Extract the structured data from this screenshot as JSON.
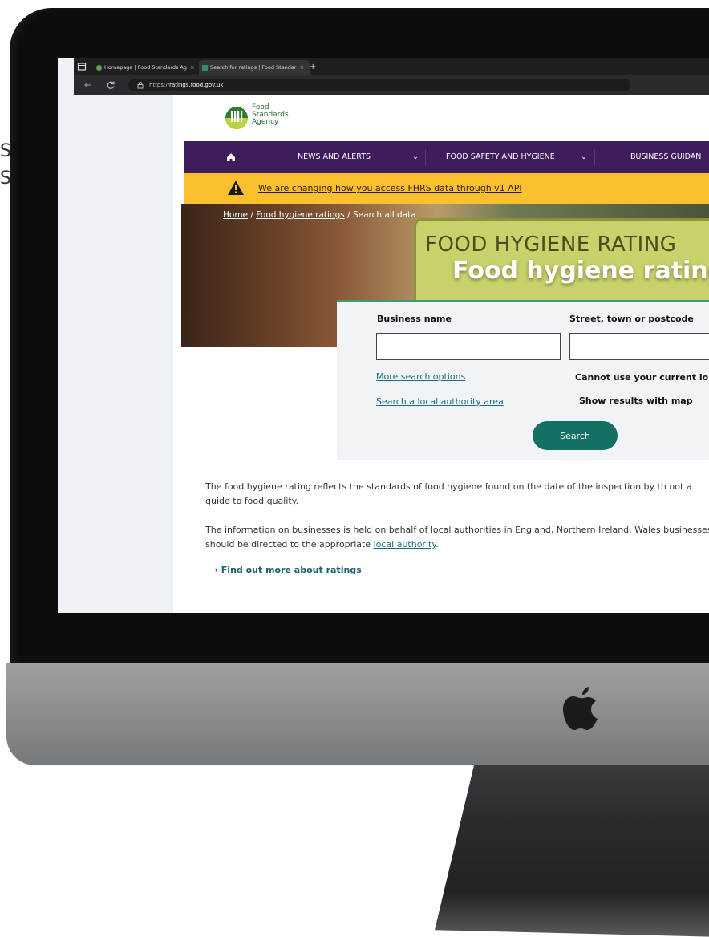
{
  "edge_text": [
    "S",
    "S"
  ],
  "browser": {
    "tabs": [
      {
        "label": "Homepage | Food Standards Ag",
        "close": "×"
      },
      {
        "label": "Search for ratings | Food Standar",
        "close": "×"
      }
    ],
    "new_tab": "+",
    "url_prefix": "https://",
    "url_host": "ratings.food.gov.uk"
  },
  "site": {
    "logo_lines": [
      "Food",
      "Standards",
      "Agency"
    ],
    "nav": [
      {
        "label": "NEWS AND ALERTS",
        "caret": "⌄"
      },
      {
        "label": "FOOD SAFETY AND HYGIENE",
        "caret": "⌄"
      },
      {
        "label": "BUSINESS GUIDAN"
      }
    ],
    "alert_text": "We are changing how you access FHRS data through v1 API",
    "breadcrumb": {
      "home": "Home",
      "sep1": "/",
      "ratings": "Food hygiene ratings",
      "sep2": "/",
      "current": "Search all data"
    },
    "hero_sign_text": "FOOD HYGIENE RATING",
    "hero_title": "Food hygiene ratings",
    "search": {
      "business_label": "Business name",
      "location_label": "Street, town or postcode",
      "more_options": "More search options",
      "local_authority": "Search a local authority area",
      "location_note": "Cannot use your current lo",
      "map_toggle": "Show results with map",
      "button": "Search"
    },
    "para1": "The food hygiene rating reflects the standards of food hygiene found on the date of the inspection by th not a guide to food quality.",
    "para2_prefix": "The information on businesses is held on behalf of local authorities in England, Northern Ireland, Wales businesses should be directed to the appropriate",
    "para2_link": "local authority",
    "para2_suffix": ".",
    "more_link": "Find out more about ratings",
    "more_arrow": "⟶"
  }
}
